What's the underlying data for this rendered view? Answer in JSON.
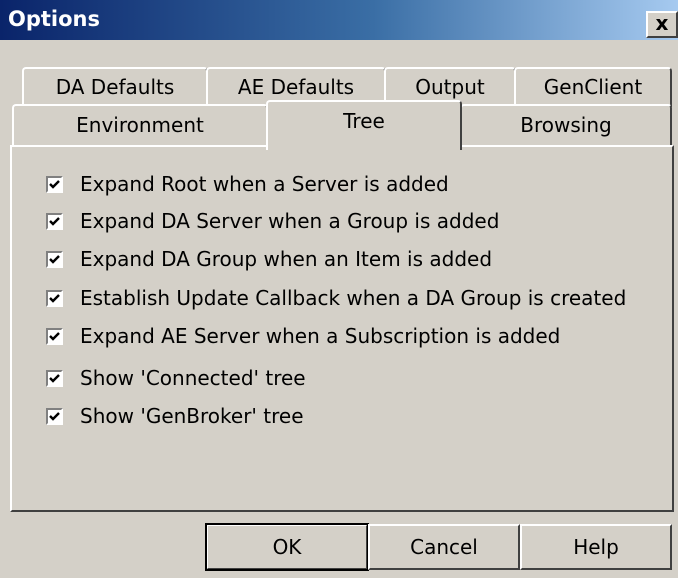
{
  "window": {
    "title": "Options",
    "close_glyph": "x"
  },
  "tabs": {
    "back_row": [
      "DA Defaults",
      "AE Defaults",
      "Output",
      "GenClient"
    ],
    "front_row": [
      "Environment",
      "Tree",
      "Browsing"
    ],
    "selected": "Tree"
  },
  "tree_options": [
    {
      "label": "Expand Root when a Server is added",
      "checked": true
    },
    {
      "label": "Expand DA Server when a Group is added",
      "checked": true
    },
    {
      "label": "Expand DA Group when an Item is added",
      "checked": true
    },
    {
      "label": "Establish Update Callback when a DA Group is created",
      "checked": true
    },
    {
      "label": "Expand AE Server when a Subscription is added",
      "checked": true
    },
    {
      "label": "Show 'Connected' tree",
      "checked": true
    },
    {
      "label": "Show 'GenBroker' tree",
      "checked": true
    }
  ],
  "buttons": {
    "ok": "OK",
    "cancel": "Cancel",
    "help": "Help"
  },
  "icons": {
    "close": "close-icon",
    "check": "check-icon"
  },
  "colors": {
    "title_start": "#0a246a",
    "title_end": "#a6caf0",
    "face": "#d4d0c8"
  }
}
